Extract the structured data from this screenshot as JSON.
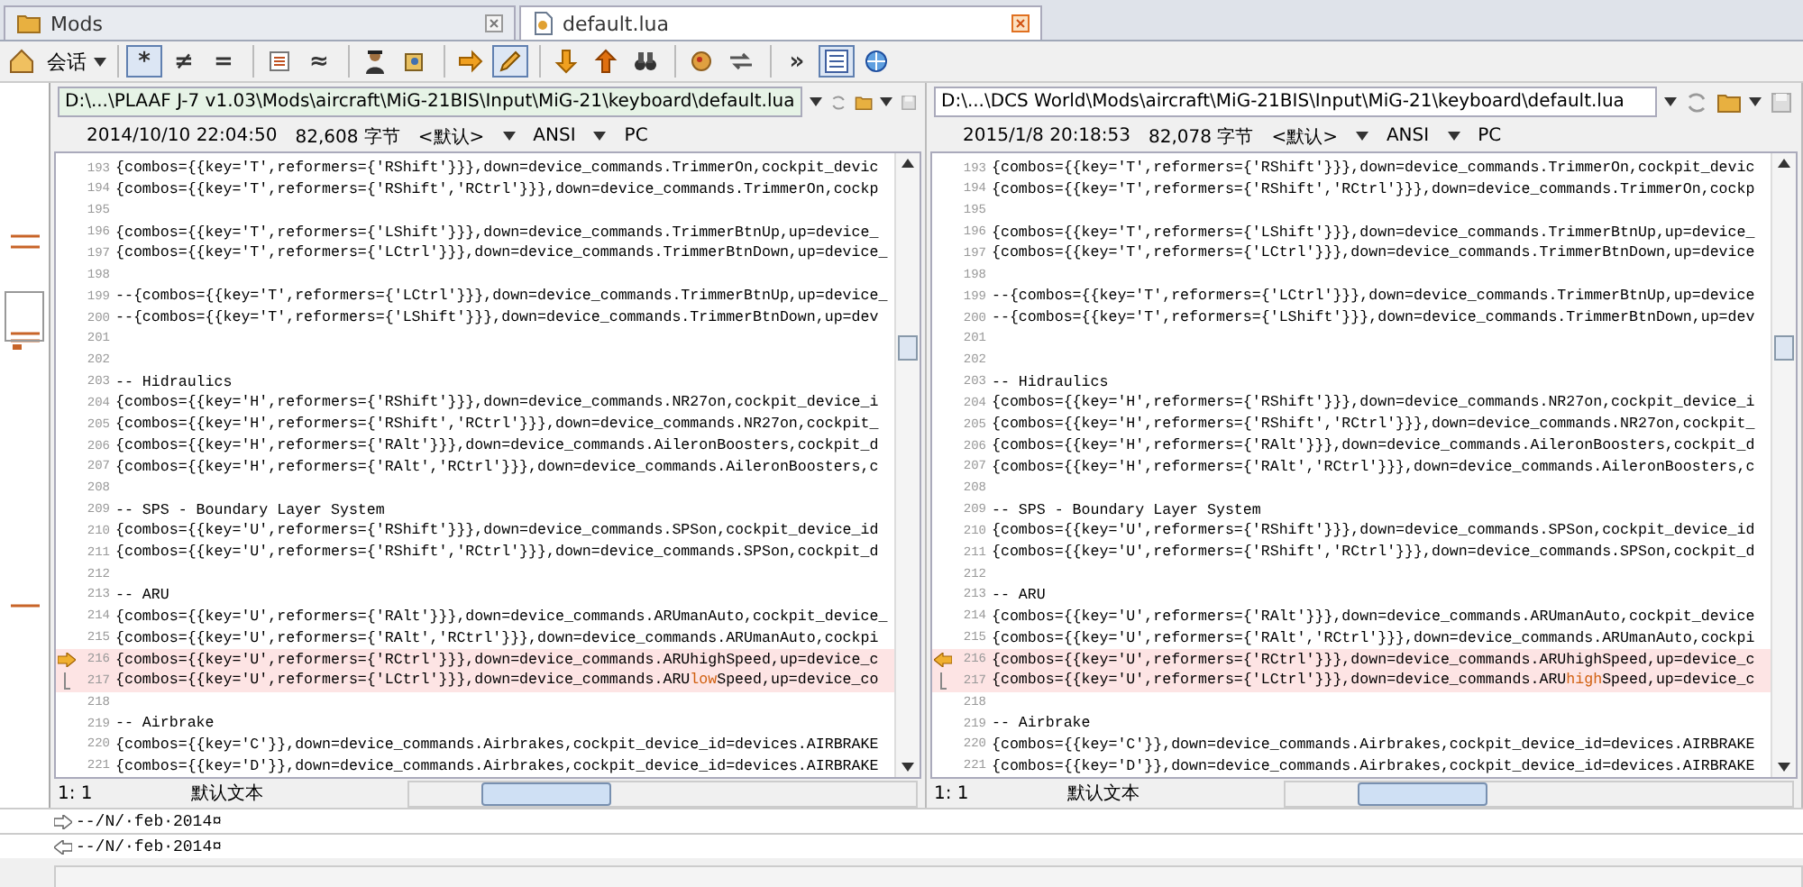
{
  "tabs": [
    {
      "label": "Mods",
      "selected": false
    },
    {
      "label": "default.lua",
      "selected": true
    }
  ],
  "toolbar": {
    "session_menu": "会话",
    "groups": [
      {
        "buttons": [
          {
            "glyph": "*",
            "pressed": true
          },
          {
            "glyph": "≠",
            "pressed": false
          },
          {
            "glyph": "=",
            "pressed": false
          }
        ]
      },
      {
        "buttons": [
          {
            "pressed": false
          },
          {
            "glyph": "≈",
            "pressed": false
          }
        ]
      },
      {
        "buttons": [
          {
            "pressed": false
          },
          {
            "pressed": false
          }
        ]
      },
      {
        "buttons": [
          {
            "pressed": false
          },
          {
            "pressed": true
          }
        ]
      },
      {
        "buttons": [
          {
            "pressed": false
          },
          {
            "pressed": false
          },
          {
            "pressed": false
          }
        ]
      },
      {
        "buttons": [
          {
            "pressed": false
          },
          {
            "pressed": false
          }
        ]
      },
      {
        "buttons": [
          {
            "glyph": "»",
            "pressed": false
          },
          {
            "pressed": true
          },
          {
            "pressed": false
          }
        ]
      }
    ]
  },
  "panes": [
    {
      "path": "D:\\...\\PLAAF J-7 v1.03\\Mods\\aircraft\\MiG-21BIS\\Input\\MiG-21\\keyboard\\default.lua",
      "focused": true,
      "timestamp": "2014/10/10 22:04:50",
      "size": "82,608 字节",
      "format": "<默认>",
      "encoding": "ANSI",
      "line_endings": "PC",
      "lines": [
        {
          "num": "193",
          "text": "{combos={{key='T',reformers={'RShift'}}},down=device_commands.TrimmerOn,cockpit_devic",
          "diff": false,
          "current": false
        },
        {
          "num": "194",
          "text": "{combos={{key='T',reformers={'RShift','RCtrl'}}},down=device_commands.TrimmerOn,cockp",
          "diff": false,
          "current": false
        },
        {
          "num": "195",
          "diff": false,
          "current": false
        },
        {
          "num": "196",
          "text": "{combos={{key='T',reformers={'LShift'}}},down=device_commands.TrimmerBtnUp,up=device_",
          "diff": false,
          "current": false
        },
        {
          "num": "197",
          "text": "{combos={{key='T',reformers={'LCtrl'}}},down=device_commands.TrimmerBtnDown,up=device_",
          "diff": false,
          "current": false
        },
        {
          "num": "198",
          "diff": false,
          "current": false
        },
        {
          "num": "199",
          "text": "--{combos={{key='T',reformers={'LCtrl'}}},down=device_commands.TrimmerBtnUp,up=device_",
          "diff": false,
          "current": false
        },
        {
          "num": "200",
          "text": "--{combos={{key='T',reformers={'LShift'}}},down=device_commands.TrimmerBtnDown,up=dev",
          "diff": false,
          "current": false
        },
        {
          "num": "201",
          "diff": false,
          "current": false
        },
        {
          "num": "202",
          "diff": false,
          "current": false
        },
        {
          "num": "203",
          "text": "-- Hidraulics",
          "diff": false,
          "current": false
        },
        {
          "num": "204",
          "text": "{combos={{key='H',reformers={'RShift'}}},down=device_commands.NR27on,cockpit_device_i",
          "diff": false,
          "current": false
        },
        {
          "num": "205",
          "text": "{combos={{key='H',reformers={'RShift','RCtrl'}}},down=device_commands.NR27on,cockpit_",
          "diff": false,
          "current": false
        },
        {
          "num": "206",
          "text": "{combos={{key='H',reformers={'RAlt'}}},down=device_commands.AileronBoosters,cockpit_d",
          "diff": false,
          "current": false
        },
        {
          "num": "207",
          "text": "{combos={{key='H',reformers={'RAlt','RCtrl'}}},down=device_commands.AileronBoosters,c",
          "diff": false,
          "current": false
        },
        {
          "num": "208",
          "diff": false,
          "current": false
        },
        {
          "num": "209",
          "text": "-- SPS - Boundary Layer System",
          "diff": false,
          "current": false
        },
        {
          "num": "210",
          "text": "{combos={{key='U',reformers={'RShift'}}},down=device_commands.SPSon,cockpit_device_id",
          "diff": false,
          "current": false
        },
        {
          "num": "211",
          "text": "{combos={{key='U',reformers={'RShift','RCtrl'}}},down=device_commands.SPSon,cockpit_d",
          "diff": false,
          "current": false
        },
        {
          "num": "212",
          "diff": false,
          "current": false
        },
        {
          "num": "213",
          "text": "-- ARU",
          "diff": false,
          "current": false
        },
        {
          "num": "214",
          "text": "{combos={{key='U',reformers={'RAlt'}}},down=device_commands.ARUmanAuto,cockpit_device_",
          "diff": false,
          "current": false
        },
        {
          "num": "215",
          "text": "{combos={{key='U',reformers={'RAlt','RCtrl'}}},down=device_commands.ARUmanAuto,cockpi",
          "diff": false,
          "current": false
        },
        {
          "num": "216",
          "text": "{combos={{key='U',reformers={'RCtrl'}}},down=device_commands.ARUhighSpeed,up=device_c",
          "diff": true,
          "current": true
        },
        {
          "num": "217",
          "parts": [
            {
              "text": "{combos={{key='U',reformers={'LCtrl'}}},down=device_commands.ARU",
              "changed": false
            },
            {
              "text": "low",
              "changed": true
            },
            {
              "text": "Speed,up=device_co",
              "changed": false
            }
          ],
          "diff": true,
          "current": true
        },
        {
          "num": "218",
          "diff": false,
          "current": false
        },
        {
          "num": "219",
          "text": "-- Airbrake",
          "diff": false,
          "current": false
        },
        {
          "num": "220",
          "text": "{combos={{key='C'}},down=device_commands.Airbrakes,cockpit_device_id=devices.AIRBRAKE",
          "diff": false,
          "current": false
        },
        {
          "num": "221",
          "text": "{combos={{key='D'}},down=device_commands.Airbrakes,cockpit_device_id=devices.AIRBRAKE",
          "diff": false,
          "current": false
        }
      ],
      "status": {
        "position": "1: 1",
        "text_format": "默认文本"
      }
    },
    {
      "path": "D:\\...\\DCS World\\Mods\\aircraft\\MiG-21BIS\\Input\\MiG-21\\keyboard\\default.lua",
      "focused": false,
      "timestamp": "2015/1/8 20:18:53",
      "size": "82,078 字节",
      "format": "<默认>",
      "encoding": "ANSI",
      "line_endings": "PC",
      "lines": [
        {
          "num": "193",
          "text": "{combos={{key='T',reformers={'RShift'}}},down=device_commands.TrimmerOn,cockpit_devic",
          "diff": false,
          "current": false
        },
        {
          "num": "194",
          "text": "{combos={{key='T',reformers={'RShift','RCtrl'}}},down=device_commands.TrimmerOn,cockp",
          "diff": false,
          "current": false
        },
        {
          "num": "195",
          "diff": false,
          "current": false
        },
        {
          "num": "196",
          "text": "{combos={{key='T',reformers={'LShift'}}},down=device_commands.TrimmerBtnUp,up=device_",
          "diff": false,
          "current": false
        },
        {
          "num": "197",
          "text": "{combos={{key='T',reformers={'LCtrl'}}},down=device_commands.TrimmerBtnDown,up=device",
          "diff": false,
          "current": false
        },
        {
          "num": "198",
          "diff": false,
          "current": false
        },
        {
          "num": "199",
          "text": "--{combos={{key='T',reformers={'LCtrl'}}},down=device_commands.TrimmerBtnUp,up=device",
          "diff": false,
          "current": false
        },
        {
          "num": "200",
          "text": "--{combos={{key='T',reformers={'LShift'}}},down=device_commands.TrimmerBtnDown,up=dev",
          "diff": false,
          "current": false
        },
        {
          "num": "201",
          "diff": false,
          "current": false
        },
        {
          "num": "202",
          "diff": false,
          "current": false
        },
        {
          "num": "203",
          "text": "-- Hidraulics",
          "diff": false,
          "current": false
        },
        {
          "num": "204",
          "text": "{combos={{key='H',reformers={'RShift'}}},down=device_commands.NR27on,cockpit_device_i",
          "diff": false,
          "current": false
        },
        {
          "num": "205",
          "text": "{combos={{key='H',reformers={'RShift','RCtrl'}}},down=device_commands.NR27on,cockpit_",
          "diff": false,
          "current": false
        },
        {
          "num": "206",
          "text": "{combos={{key='H',reformers={'RAlt'}}},down=device_commands.AileronBoosters,cockpit_d",
          "diff": false,
          "current": false
        },
        {
          "num": "207",
          "text": "{combos={{key='H',reformers={'RAlt','RCtrl'}}},down=device_commands.AileronBoosters,c",
          "diff": false,
          "current": false
        },
        {
          "num": "208",
          "diff": false,
          "current": false
        },
        {
          "num": "209",
          "text": "-- SPS - Boundary Layer System",
          "diff": false,
          "current": false
        },
        {
          "num": "210",
          "text": "{combos={{key='U',reformers={'RShift'}}},down=device_commands.SPSon,cockpit_device_id",
          "diff": false,
          "current": false
        },
        {
          "num": "211",
          "text": "{combos={{key='U',reformers={'RShift','RCtrl'}}},down=device_commands.SPSon,cockpit_d",
          "diff": false,
          "current": false
        },
        {
          "num": "212",
          "diff": false,
          "current": false
        },
        {
          "num": "213",
          "text": "-- ARU",
          "diff": false,
          "current": false
        },
        {
          "num": "214",
          "text": "{combos={{key='U',reformers={'RAlt'}}},down=device_commands.ARUmanAuto,cockpit_device",
          "diff": false,
          "current": false
        },
        {
          "num": "215",
          "text": "{combos={{key='U',reformers={'RAlt','RCtrl'}}},down=device_commands.ARUmanAuto,cockpi",
          "diff": false,
          "current": false
        },
        {
          "num": "216",
          "text": "{combos={{key='U',reformers={'RCtrl'}}},down=device_commands.ARUhighSpeed,up=device_c",
          "diff": true,
          "current": true
        },
        {
          "num": "217",
          "parts": [
            {
              "text": "{combos={{key='U',reformers={'LCtrl'}}},down=device_commands.ARU",
              "changed": false
            },
            {
              "text": "high",
              "changed": true
            },
            {
              "text": "Speed,up=device_c",
              "changed": false
            }
          ],
          "diff": true,
          "current": true
        },
        {
          "num": "218",
          "diff": false,
          "current": false
        },
        {
          "num": "219",
          "text": "-- Airbrake",
          "diff": false,
          "current": false
        },
        {
          "num": "220",
          "text": "{combos={{key='C'}},down=device_commands.Airbrakes,cockpit_device_id=devices.AIRBRAKE",
          "diff": false,
          "current": false
        },
        {
          "num": "221",
          "text": "{combos={{key='D'}},down=device_commands.Airbrakes,cockpit_device_id=devices.AIRBRAKE",
          "diff": false,
          "current": false
        }
      ],
      "status": {
        "position": "1: 1",
        "text_format": "默认文本"
      }
    }
  ],
  "line_details": [
    {
      "kind": "right",
      "text": "--/N/·feb·2014¤"
    },
    {
      "kind": "left",
      "text": "--/N/·feb·2014¤"
    }
  ]
}
